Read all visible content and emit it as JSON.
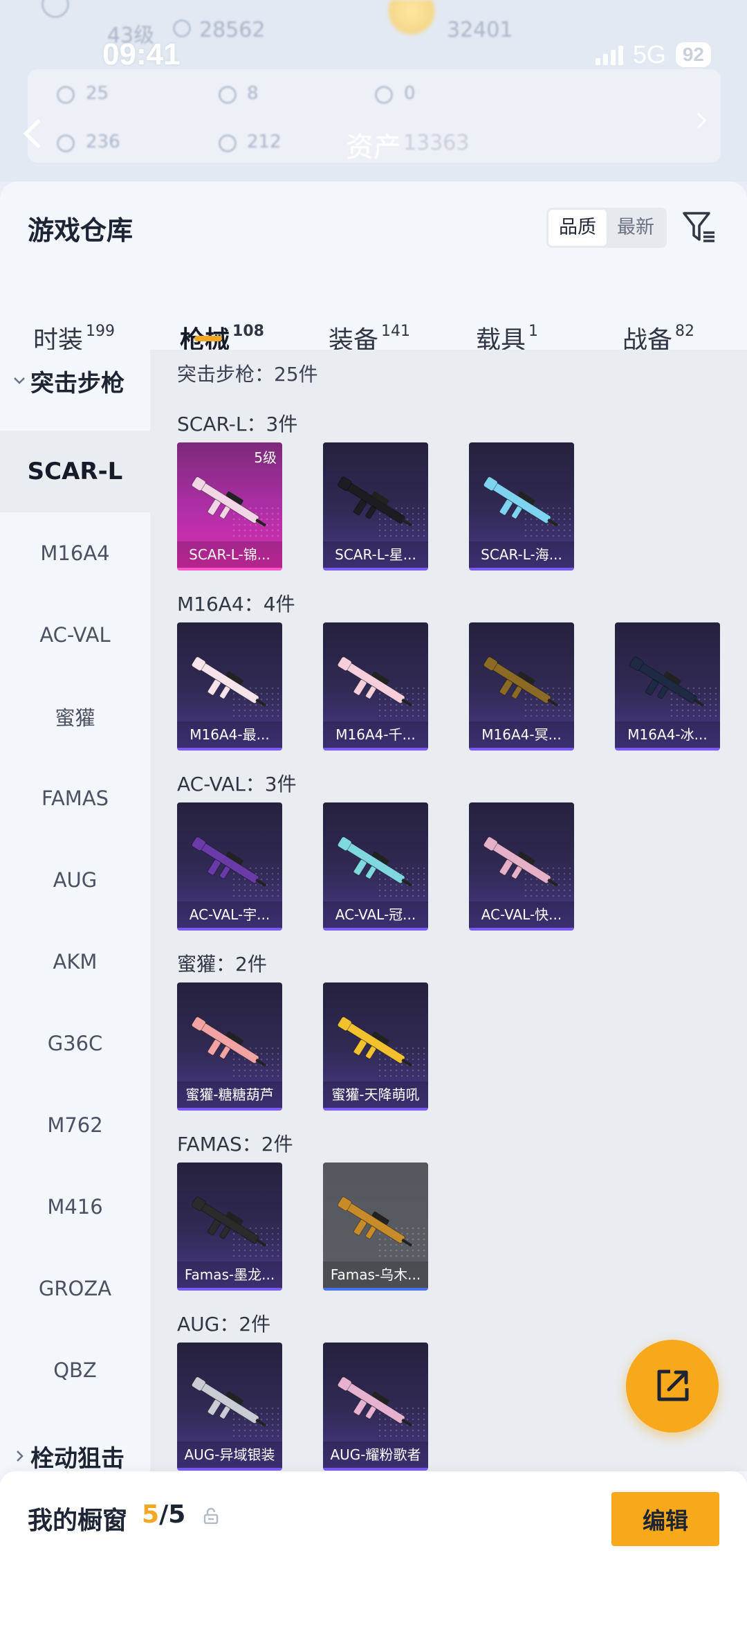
{
  "status_bar": {
    "time": "09:41",
    "network": "5G",
    "battery": "92"
  },
  "profile_bg": {
    "level": "43级",
    "coins": "28562",
    "points": "32401",
    "stats": [
      "25",
      "8",
      "0",
      "236",
      "212"
    ],
    "asset_label": "资产",
    "asset_value": "13363"
  },
  "sheet": {
    "title": "游戏仓库",
    "sort_options": [
      "品质",
      "最新"
    ],
    "sort_active": 0
  },
  "tabs": [
    {
      "label": "时装",
      "count": "199"
    },
    {
      "label": "枪械",
      "count": "108"
    },
    {
      "label": "装备",
      "count": "141"
    },
    {
      "label": "载具",
      "count": "1"
    },
    {
      "label": "战备",
      "count": "82"
    }
  ],
  "sidebar": {
    "category_open": "突击步枪",
    "items": [
      "SCAR-L",
      "M16A4",
      "AC-VAL",
      "蜜獾",
      "FAMAS",
      "AUG",
      "AKM",
      "G36C",
      "M762",
      "M416",
      "GROZA",
      "QBZ"
    ],
    "active": 0,
    "category_next": "栓动狙击"
  },
  "content": {
    "category_summary": "突击步枪：25件",
    "groups": [
      {
        "title": "SCAR-L：3件",
        "items": [
          {
            "name": "SCAR-L-锦...",
            "level": "5级",
            "rarity": "pink"
          },
          {
            "name": "SCAR-L-星...",
            "rarity": "purple"
          },
          {
            "name": "SCAR-L-海...",
            "rarity": "purple"
          }
        ]
      },
      {
        "title": "M16A4：4件",
        "items": [
          {
            "name": "M16A4-最...",
            "rarity": "purple"
          },
          {
            "name": "M16A4-千...",
            "rarity": "purple"
          },
          {
            "name": "M16A4-冥...",
            "rarity": "purple"
          },
          {
            "name": "M16A4-冰...",
            "rarity": "purple"
          }
        ]
      },
      {
        "title": "AC-VAL：3件",
        "items": [
          {
            "name": "AC-VAL-宇...",
            "rarity": "purple"
          },
          {
            "name": "AC-VAL-冠...",
            "rarity": "purple"
          },
          {
            "name": "AC-VAL-快...",
            "rarity": "purple"
          }
        ]
      },
      {
        "title": "蜜獾：2件",
        "items": [
          {
            "name": "蜜獾-糖糖葫芦",
            "rarity": "purple"
          },
          {
            "name": "蜜獾-天降萌吼",
            "rarity": "purple"
          }
        ]
      },
      {
        "title": "FAMAS：2件",
        "items": [
          {
            "name": "Famas-墨龙...",
            "rarity": "purple"
          },
          {
            "name": "Famas-乌木...",
            "rarity": "grey"
          }
        ]
      },
      {
        "title": "AUG：2件",
        "items": [
          {
            "name": "AUG-异域银装",
            "rarity": "purple"
          },
          {
            "name": "AUG-耀粉歌者",
            "rarity": "purple"
          }
        ]
      }
    ]
  },
  "bottom_bar": {
    "title": "我的橱窗",
    "count_current": "5",
    "count_sep": "/",
    "count_total": "5",
    "edit_label": "编辑"
  },
  "colors": {
    "accent": "#f7a81b",
    "purple_card": "#312a55",
    "pink_card": "#b02fa8",
    "grey_card": "#5d5f66"
  },
  "icons": [
    "back-chevron-icon",
    "filter-icon",
    "lock-icon",
    "share-icon",
    "chevron-down-icon",
    "chevron-right-icon"
  ]
}
